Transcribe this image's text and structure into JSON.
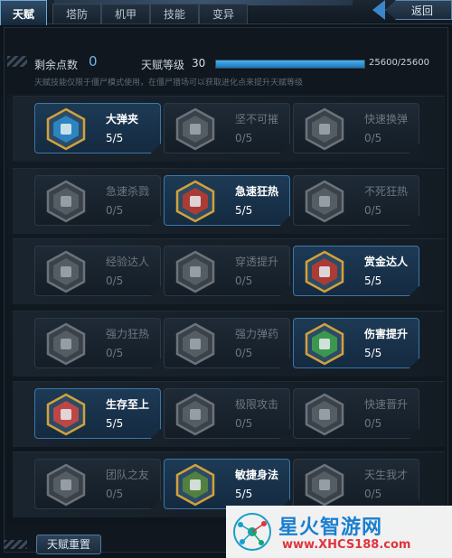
{
  "tabs": [
    {
      "label": "天赋",
      "active": true
    },
    {
      "label": "塔防",
      "active": false
    },
    {
      "label": "机甲",
      "active": false
    },
    {
      "label": "技能",
      "active": false
    },
    {
      "label": "变异",
      "active": false
    }
  ],
  "back_label": "返回",
  "summary": {
    "remaining_label": "剩余点数",
    "remaining_value": "0",
    "level_label": "天赋等级",
    "level_value": "30",
    "progress_text": "25600/25600",
    "progress_fraction": 1.0,
    "description": "天赋技能仅限于僵尸模式使用，在僵尸猎场可以获取进化点来提升天赋等级"
  },
  "talents": [
    {
      "name": "大弹夹",
      "level": "5/5",
      "active": true,
      "icon": "ammo-clip-icon"
    },
    {
      "name": "坚不可摧",
      "level": "0/5",
      "active": false,
      "icon": "helmet-icon"
    },
    {
      "name": "快速换弹",
      "level": "0/5",
      "active": false,
      "icon": "hand-reload-icon"
    },
    {
      "name": "急速杀戮",
      "level": "0/5",
      "active": false,
      "icon": "fist-icon"
    },
    {
      "name": "急速狂热",
      "level": "5/5",
      "active": true,
      "icon": "rage-icon"
    },
    {
      "name": "不死狂热",
      "level": "0/5",
      "active": false,
      "icon": "skull-icon"
    },
    {
      "name": "经验达人",
      "level": "0/5",
      "active": false,
      "icon": "exp-arrow-icon"
    },
    {
      "name": "穿透提升",
      "level": "0/5",
      "active": false,
      "icon": "penetrate-icon"
    },
    {
      "name": "赏金达人",
      "level": "5/5",
      "active": true,
      "icon": "bounty-coin-icon"
    },
    {
      "name": "强力狂热",
      "level": "0/5",
      "active": false,
      "icon": "power-rage-icon"
    },
    {
      "name": "强力弹药",
      "level": "0/5",
      "active": false,
      "icon": "power-ammo-icon"
    },
    {
      "name": "伤害提升",
      "level": "5/5",
      "active": true,
      "icon": "gun-damage-icon"
    },
    {
      "name": "生存至上",
      "level": "5/5",
      "active": true,
      "icon": "medkit-icon"
    },
    {
      "name": "极限攻击",
      "level": "0/5",
      "active": false,
      "icon": "extreme-attack-icon"
    },
    {
      "name": "快速晋升",
      "level": "0/5",
      "active": false,
      "icon": "rank-up-icon"
    },
    {
      "name": "团队之友",
      "level": "0/5",
      "active": false,
      "icon": "team-gun-icon"
    },
    {
      "name": "敏捷身法",
      "level": "5/5",
      "active": true,
      "icon": "agile-soldier-icon"
    },
    {
      "name": "天生我才",
      "level": "0/5",
      "active": false,
      "icon": "eye-icon"
    }
  ],
  "reset_label": "天赋重置",
  "watermark": {
    "title": "星火智游网",
    "url": "www.XHCS188.com"
  },
  "colors": {
    "accent": "#3c77a8",
    "progress": "#2b8fd6",
    "remaining": "#6fb6e8"
  }
}
